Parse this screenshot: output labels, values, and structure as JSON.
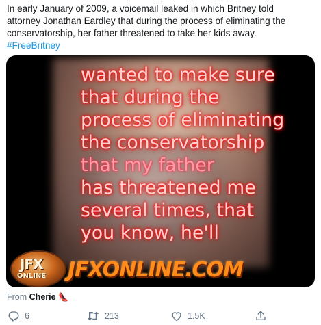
{
  "tweet": {
    "text_line1": "In early January of 2009, a voicemail leaked in which Britney told",
    "text_line2": "attorney Jonathan Eardley that during the process of eliminating the",
    "text_line3": "conservatorship, her father threatened to take her kids away.",
    "hashtag": "#FreeBritney"
  },
  "media": {
    "caption_lines": [
      "wanted to make sure",
      "that during the",
      "process of eliminating",
      "the conservatorship",
      "that my father",
      "has threatened me",
      "several times, that",
      "you know, he'll"
    ],
    "logo_top": "JFX",
    "logo_bottom": "ONLINE",
    "site_text": "JFXONLINE.COM"
  },
  "attribution": {
    "prefix": "From",
    "user": "Cherie",
    "emoji": "👠"
  },
  "actions": {
    "reply_count": "6",
    "retweet_count": "213",
    "like_count": "1.5K",
    "share_label": ""
  },
  "colors": {
    "text": "#14171a",
    "secondary": "#657786",
    "link": "#1b95e0",
    "caption_glow": "#ff0000",
    "site_orange": "#ff8c1a"
  }
}
